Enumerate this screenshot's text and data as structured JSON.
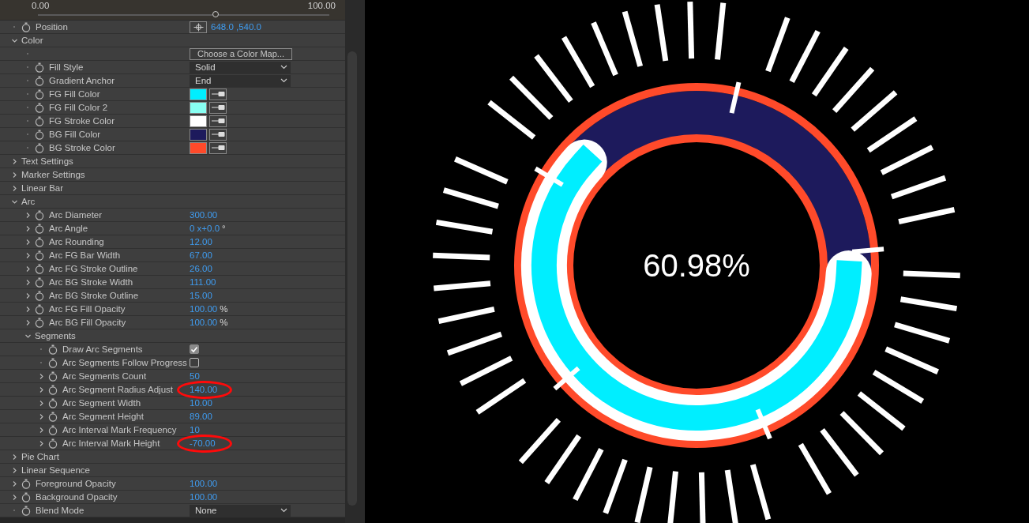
{
  "slider": {
    "min_label": "0.00",
    "max_label": "100.00",
    "level": 0.61
  },
  "properties": [
    {
      "kind": "point",
      "label": "Position",
      "expandable": false,
      "value": "648.0 ,540.0"
    },
    {
      "kind": "group",
      "label": "Color",
      "expanded": true,
      "children": [
        {
          "kind": "button",
          "label": "Choose a Color Map...",
          "expandable": false
        },
        {
          "kind": "dropdown",
          "label": "Fill Style",
          "expandable": false,
          "value": "Solid"
        },
        {
          "kind": "dropdown",
          "label": "Gradient Anchor",
          "expandable": false,
          "value": "End"
        },
        {
          "kind": "color",
          "label": "FG Fill Color",
          "expandable": false,
          "color": "#00eeff"
        },
        {
          "kind": "color",
          "label": "FG Fill Color 2",
          "expandable": false,
          "color": "#88fff2"
        },
        {
          "kind": "color",
          "label": "FG Stroke Color",
          "expandable": false,
          "color": "#ffffff"
        },
        {
          "kind": "color",
          "label": "BG Fill Color",
          "expandable": false,
          "color": "#1d1a5c"
        },
        {
          "kind": "color",
          "label": "BG Stroke Color",
          "expandable": false,
          "color": "#ff4a2a"
        }
      ]
    },
    {
      "kind": "group",
      "label": "Text Settings",
      "expanded": false
    },
    {
      "kind": "group",
      "label": "Marker Settings",
      "expanded": false
    },
    {
      "kind": "group",
      "label": "Linear Bar",
      "expanded": false
    },
    {
      "kind": "group",
      "label": "Arc",
      "expanded": true,
      "children": [
        {
          "kind": "number",
          "label": "Arc Diameter",
          "expandable": true,
          "value": "300.00",
          "circled": false
        },
        {
          "kind": "number",
          "label": "Arc Angle",
          "expandable": true,
          "value": "0 x+0.0",
          "unit": "°",
          "circled": false
        },
        {
          "kind": "number",
          "label": "Arc Rounding",
          "expandable": true,
          "value": "12.00",
          "circled": false
        },
        {
          "kind": "number",
          "label": "Arc FG Bar Width",
          "expandable": true,
          "value": "67.00",
          "circled": false
        },
        {
          "kind": "number",
          "label": "Arc FG Stroke Outline",
          "expandable": true,
          "value": "26.00",
          "circled": false
        },
        {
          "kind": "number",
          "label": "Arc BG Stroke Width",
          "expandable": true,
          "value": "111.00",
          "circled": false
        },
        {
          "kind": "number",
          "label": "Arc BG Stroke Outline",
          "expandable": true,
          "value": "15.00",
          "circled": false
        },
        {
          "kind": "number",
          "label": "Arc FG Fill Opacity",
          "expandable": true,
          "value": "100.00",
          "unit": "%",
          "circled": false
        },
        {
          "kind": "number",
          "label": "Arc BG Fill Opacity",
          "expandable": true,
          "value": "100.00",
          "unit": "%",
          "circled": false
        },
        {
          "kind": "group",
          "label": "Segments",
          "expanded": true,
          "children": [
            {
              "kind": "checkbox",
              "label": "Draw Arc Segments",
              "expandable": false,
              "checked": true
            },
            {
              "kind": "checkbox",
              "label": "Arc Segments Follow Progress",
              "expandable": false,
              "checked": false
            },
            {
              "kind": "number",
              "label": "Arc Segments Count",
              "expandable": true,
              "value": "50",
              "circled": false
            },
            {
              "kind": "number",
              "label": "Arc Segment Radius Adjust",
              "expandable": true,
              "value": "140.00",
              "circled": true
            },
            {
              "kind": "number",
              "label": "Arc Segment Width",
              "expandable": true,
              "value": "10.00",
              "circled": false
            },
            {
              "kind": "number",
              "label": "Arc Segment Height",
              "expandable": true,
              "value": "89.00",
              "circled": false
            },
            {
              "kind": "number",
              "label": "Arc Interval Mark Frequency",
              "expandable": true,
              "value": "10",
              "circled": false
            },
            {
              "kind": "number",
              "label": "Arc Interval Mark Height",
              "expandable": true,
              "value": "-70.00",
              "circled": true
            }
          ]
        }
      ]
    },
    {
      "kind": "group",
      "label": "Pie Chart",
      "expanded": false
    },
    {
      "kind": "group",
      "label": "Linear Sequence",
      "expanded": false
    },
    {
      "kind": "number",
      "label": "Foreground Opacity",
      "expandable": true,
      "value": "100.00",
      "circled": false
    },
    {
      "kind": "number",
      "label": "Background Opacity",
      "expandable": true,
      "value": "100.00",
      "circled": false
    },
    {
      "kind": "dropdown",
      "label": "Blend Mode",
      "expandable": false,
      "value": "None"
    }
  ],
  "preview": {
    "label": "60.98%"
  }
}
